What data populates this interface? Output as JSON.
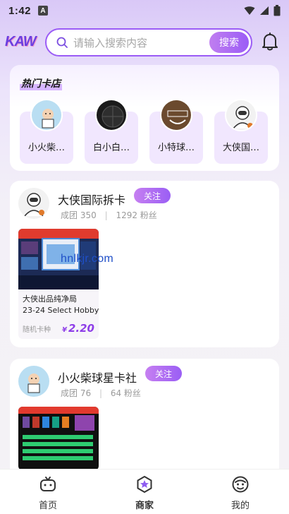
{
  "status_bar": {
    "time": "1:42",
    "indicator": "A"
  },
  "header": {
    "logo": "KAW",
    "search": {
      "placeholder": "请输入搜索内容",
      "button": "搜索"
    },
    "icons": [
      "search-icon",
      "bell-icon"
    ]
  },
  "hot_shops": {
    "title": "热门卡店",
    "items": [
      {
        "name": "小火柴…"
      },
      {
        "name": "白小白…"
      },
      {
        "name": "小特球…"
      },
      {
        "name": "大侠国…"
      }
    ]
  },
  "stores": [
    {
      "name": "大侠国际拆卡",
      "follow": "关注",
      "deals_label": "成团",
      "deals": "350",
      "fans": "1292 粉丝",
      "product": {
        "title": "大侠出品纯净局",
        "subtitle": "23-24 Select Hobby",
        "tag": "随机卡种",
        "currency": "¥",
        "price": "2.20"
      }
    },
    {
      "name": "小火柴球星卡社",
      "follow": "关注",
      "deals_label": "成团",
      "deals": "76",
      "fans": "64 粉丝"
    }
  ],
  "watermark": "hnlkjr.com",
  "bottom_nav": [
    {
      "label": "首页",
      "icon": "gamepad-icon"
    },
    {
      "label": "商家",
      "icon": "star-badge-icon",
      "active": true
    },
    {
      "label": "我的",
      "icon": "face-icon"
    }
  ],
  "colors": {
    "accent": "#9b5cf6",
    "price": "#8e3ee8",
    "background": "#f4f3f6"
  }
}
